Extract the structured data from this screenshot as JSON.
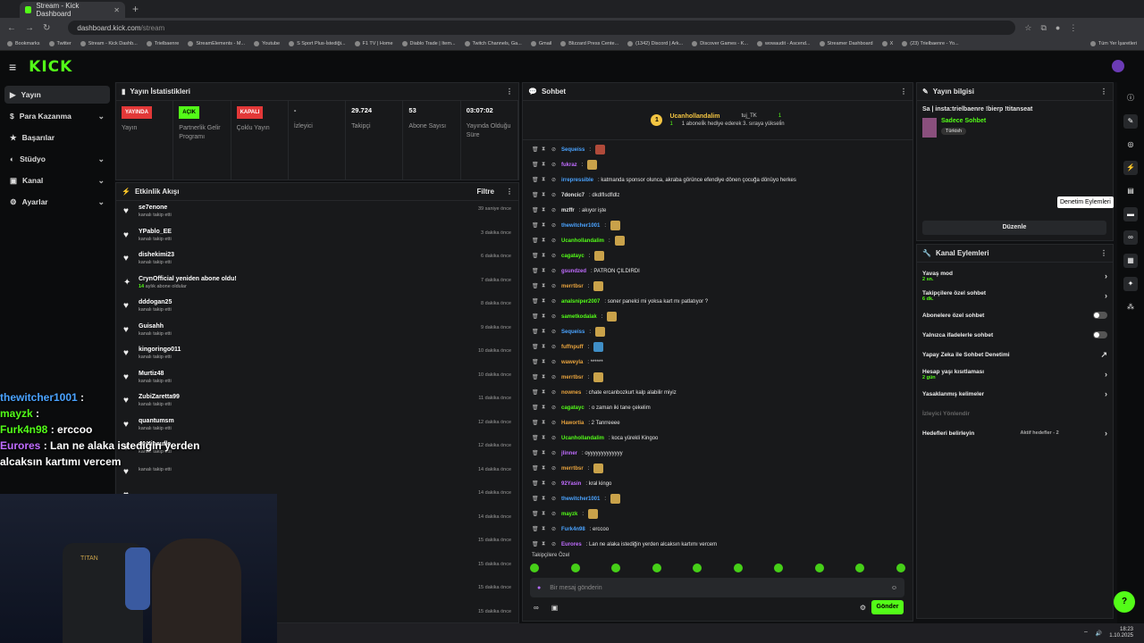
{
  "browser": {
    "tab_title": "Stream - Kick Dashboard",
    "url_host": "dashboard.kick.com",
    "url_path": "/stream",
    "bookmarks": [
      "Bookmarks",
      "Twitter",
      "Stream - Kick Dashb...",
      "Trielbaenre",
      "StreamElements - M...",
      "Youtube",
      "S Sport Plus-İstediği...",
      "F1 TV | Home",
      "Diablo Trade | Item...",
      "Twitch Channels, Ga...",
      "Gmail",
      "Blizzard Press Cente...",
      "(1342) Discord | Ark...",
      "Discover Games - K...",
      "wowaudit - Ascend...",
      "Streamer Dashboard",
      "X",
      "(23) Trielbaenre - Yo..."
    ],
    "bookmarks_right": "Tüm Yer İşaretleri"
  },
  "logo": "KICK",
  "sidebar": [
    {
      "label": "Yayın",
      "active": true
    },
    {
      "label": "Para Kazanma",
      "chev": "⌄"
    },
    {
      "label": "Başarılar"
    },
    {
      "label": "Stüdyo",
      "chev": "⌄"
    },
    {
      "label": "Kanal",
      "chev": "⌄"
    },
    {
      "label": "Ayarlar",
      "chev": "⌄"
    }
  ],
  "stats": {
    "title": "Yayın İstatistikleri",
    "items": [
      {
        "badge": "YAYINDA",
        "label": "Yayın",
        "color": "red"
      },
      {
        "badge": "AÇIK",
        "label": "Partnerlik Gelir Programı",
        "color": "green"
      },
      {
        "badge": "KAPALI",
        "label": "Çoklu Yayın",
        "color": "red"
      },
      {
        "num": "-",
        "label": "İzleyici"
      },
      {
        "num": "29.724",
        "label": "Takipçi"
      },
      {
        "num": "53",
        "label": "Abone Sayısı"
      },
      {
        "num": "03:07:02",
        "label": "Yayında Olduğu Süre"
      }
    ]
  },
  "activity": {
    "title": "Etkinlik Akışı",
    "filter": "Filtre",
    "items": [
      {
        "name": "se7enone",
        "sub": "kanalı takip etti",
        "time": "39 saniye önce"
      },
      {
        "name": "YPablo_EE",
        "sub": "kanalı takip etti",
        "time": "3 dakika önce"
      },
      {
        "name": "dishekimi23",
        "sub": "kanalı takip etti",
        "time": "6 dakika önce"
      },
      {
        "name": "CrynOfficial yeniden abone oldu!",
        "num": "14",
        "sub": " aylık abone oldular",
        "time": "7 dakika önce",
        "star": true
      },
      {
        "name": "dddogan25",
        "sub": "kanalı takip etti",
        "time": "8 dakika önce"
      },
      {
        "name": "Guisahh",
        "sub": "kanalı takip etti",
        "time": "9 dakika önce"
      },
      {
        "name": "kingoringo011",
        "sub": "kanalı takip etti",
        "time": "10 dakika önce"
      },
      {
        "name": "Murtiz48",
        "sub": "kanalı takip etti",
        "time": "10 dakika önce"
      },
      {
        "name": "ZubiZaretta99",
        "sub": "kanalı takip etti",
        "time": "11 dakika önce"
      },
      {
        "name": "quantumsm",
        "sub": "kanalı takip etti",
        "time": "12 dakika önce"
      },
      {
        "name": "zeytinsufle",
        "sub": "kanalı takip etti",
        "time": "12 dakika önce"
      },
      {
        "name": "",
        "sub": "kanalı takip etti",
        "time": "14 dakika önce"
      },
      {
        "name": "",
        "sub": "",
        "time": "14 dakika önce"
      },
      {
        "name": "",
        "sub": "",
        "time": "14 dakika önce"
      },
      {
        "name": "",
        "sub": "",
        "time": "15 dakika önce"
      },
      {
        "name": "",
        "sub": "",
        "time": "15 dakika önce"
      },
      {
        "name": "",
        "sub": "",
        "time": "15 dakika önce"
      },
      {
        "name": "",
        "sub": "",
        "time": "15 dakika önce"
      }
    ]
  },
  "chat": {
    "title": "Sohbet",
    "pinned": {
      "user": "Ucanhollandalim",
      "count": "1",
      "user2": "tuj_TK",
      "count2": "1",
      "text": "1 aboneli̇k hediye ederek 3. sıraya yükseli̇n"
    },
    "messages": [
      {
        "user": "Sequeiss",
        "color": "#4aa3ff",
        "text": ":",
        "emote": "red"
      },
      {
        "user": "fukraz",
        "color": "#c06cff",
        "text": ":",
        "emote": "gold"
      },
      {
        "user": "irrepressible",
        "color": "#4aa3ff",
        "text": ": katmanda sponsor olunca, akraba görünce efendiye dönen çocuğa dönüyo herkes"
      },
      {
        "user": "7doncic7",
        "color": "#e6e6e6",
        "text": ": dkdlflsdfldlz"
      },
      {
        "user": "mzffr",
        "color": "#e6e6e6",
        "text": ": akıyor işte"
      },
      {
        "user": "thewitcher1001",
        "color": "#4aa3ff",
        "text": ":",
        "emote": "gold"
      },
      {
        "user": "Ucanhollandalim",
        "color": "#53fc18",
        "text": ":",
        "emote": "gold"
      },
      {
        "user": "cagatayc",
        "color": "#53fc18",
        "text": ":",
        "emote": "gold"
      },
      {
        "user": "gsundzed",
        "color": "#c06cff",
        "text": ": PATRON ÇILDIRDI"
      },
      {
        "user": "merrtbsr",
        "color": "#e8a33d",
        "text": ":",
        "emote": "gold"
      },
      {
        "user": "analsniper2007",
        "color": "#53fc18",
        "text": ": soner panelci mi yoksa kart mı patlatıyor ?"
      },
      {
        "user": "sametkodalak",
        "color": "#53fc18",
        "text": ":",
        "emote": "gold"
      },
      {
        "user": "Sequeiss",
        "color": "#4aa3ff",
        "text": ":",
        "emote": "gold"
      },
      {
        "user": "fuffnpuff",
        "color": "#e8a33d",
        "text": ":",
        "emote": "blue"
      },
      {
        "user": "waweyla",
        "color": "#e8a33d",
        "text": ": ******"
      },
      {
        "user": "merrtbsr",
        "color": "#e8a33d",
        "text": ":",
        "emote": "gold"
      },
      {
        "user": "nownes",
        "color": "#e8a33d",
        "text": ": chate ercanbozkurt kalp alabilir miyiz"
      },
      {
        "user": "cagatayc",
        "color": "#53fc18",
        "text": ": o zaman iki tane çekelim"
      },
      {
        "user": "Hawortia",
        "color": "#e8a33d",
        "text": ": 2 Tanrreeee"
      },
      {
        "user": "Ucanhollandalim",
        "color": "#53fc18",
        "text": ": koca yürekli Kingoo"
      },
      {
        "user": "jlinner",
        "color": "#c06cff",
        "text": ": oyyyyyyyyyyyyy"
      },
      {
        "user": "merrtbsr",
        "color": "#e8a33d",
        "text": ":",
        "emote": "gold"
      },
      {
        "user": "92Yasin",
        "color": "#c06cff",
        "text": ": kral kingo"
      },
      {
        "user": "thewitcher1001",
        "color": "#4aa3ff",
        "text": ":",
        "emote": "gold"
      },
      {
        "user": "mayzk",
        "color": "#53fc18",
        "text": ":",
        "emote": "gold"
      },
      {
        "user": "Furk4n98",
        "color": "#4aa3ff",
        "text": ": erccoo"
      },
      {
        "user": "Eurores",
        "color": "#c06cff",
        "text": ": Lan ne alaka istediğin yerden alcaksın kartımı vercem"
      }
    ],
    "followers_only": "Takipçilere Özel",
    "input_placeholder": "Bir mesaj gönderin",
    "send": "Gönder"
  },
  "stream_info": {
    "title": "Yayın bilgisi",
    "stream_title": "Sa | insta:trielbaenre !bierp !titanseat",
    "category": "Sadece Sohbet",
    "tag": "Türkish",
    "edit": "Düzenle"
  },
  "channel_actions": {
    "title": "Kanal Eylemleri",
    "items": [
      {
        "label": "Yavaş mod",
        "sub": "2 sn.",
        "type": "arrow"
      },
      {
        "label": "Takipçilere özel sohbet",
        "sub": "6 dk.",
        "type": "arrow"
      },
      {
        "label": "Abonelere özel sohbet",
        "type": "toggle"
      },
      {
        "label": "Yalnızca ifadelerle sohbet",
        "type": "toggle"
      },
      {
        "label": "Yapay Zeka ile Sohbet Denetimi",
        "type": "ext"
      },
      {
        "label": "Hesap yaşı kısıtlaması",
        "sub": "2 gün",
        "type": "arrow"
      },
      {
        "label": "Yasaklanmış kelimeler",
        "type": "arrow"
      },
      {
        "label": "İzleyici Yönlendir",
        "type": "dim"
      },
      {
        "label": "Hedefleri belirleyin",
        "right": "Aktif hedefler - 2",
        "type": "arrow"
      }
    ]
  },
  "tooltip": "Denetim Eylemleri",
  "overlay": [
    {
      "user": "thewitcher1001",
      "text": " :"
    },
    {
      "user": "mayzk",
      "text": " :"
    },
    {
      "user": "Furk4n98",
      "text": " : erccoo"
    },
    {
      "user": "Eurores",
      "text": " : Lan ne alaka istediğin yerden"
    },
    {
      "user": "",
      "text": "alcaksın kartımı vercem"
    }
  ],
  "cam": {
    "chair_brand": "TITAN"
  },
  "taskbar": {
    "time": "18:23",
    "date": "1.10.2025"
  },
  "colors": {
    "accent": "#53fc18",
    "bg": "#0f1012",
    "panel": "#18191b"
  }
}
